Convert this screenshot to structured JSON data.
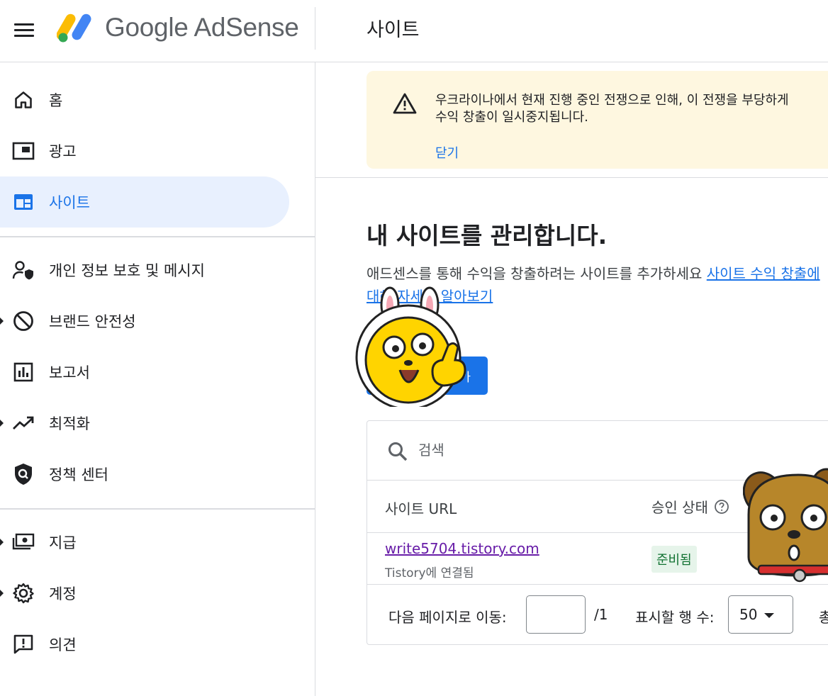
{
  "header": {
    "brand": "Google AdSense",
    "page_title": "사이트"
  },
  "sidebar": {
    "items": [
      {
        "label": "홈",
        "icon": "home-icon"
      },
      {
        "label": "광고",
        "icon": "ads-icon"
      },
      {
        "label": "사이트",
        "icon": "sites-icon",
        "active": true
      },
      {
        "label": "개인 정보 보호 및 메시지",
        "icon": "privacy-icon"
      },
      {
        "label": "브랜드 안전성",
        "icon": "block-icon",
        "expandable": true
      },
      {
        "label": "보고서",
        "icon": "report-icon"
      },
      {
        "label": "최적화",
        "icon": "trending-icon",
        "expandable": true
      },
      {
        "label": "정책 센터",
        "icon": "policy-icon"
      },
      {
        "label": "지급",
        "icon": "payments-icon",
        "expandable": true
      },
      {
        "label": "계정",
        "icon": "settings-icon",
        "expandable": true
      },
      {
        "label": "의견",
        "icon": "feedback-icon"
      }
    ]
  },
  "alert": {
    "text": "우크라이나에서 현재 진행 중인 전쟁으로 인해, 이 전쟁을 부당하게\n수익 창출이 일시중지됩니다.",
    "close_label": "닫기"
  },
  "main": {
    "heading": "내 사이트를 관리합니다.",
    "description": "애드센스를 통해 수익을 창출하려는 사이트를 추가하세요 ",
    "learn_more": "사이트 수익 창출에 대해 자세히 알아보기",
    "add_button": "추가"
  },
  "table": {
    "search_placeholder": "검색",
    "columns": [
      "사이트 URL",
      "승인 상태"
    ],
    "rows": [
      {
        "url": "write5704.tistory.com",
        "sub": "Tistory에 연결됨",
        "status": "준비됨"
      }
    ]
  },
  "pager": {
    "goto_label": "다음 페이지로 이동:",
    "page_value": "",
    "page_total": "/1",
    "rows_label": "표시할 행 수:",
    "rows_value": "50",
    "total_trunc": "총"
  },
  "colors": {
    "accent": "#1a73e8",
    "active_bg": "#e8f0fe",
    "alert_bg": "#fef7e0",
    "badge_bg": "#e6f4ea",
    "badge_text": "#137333",
    "visited_link": "#681da8"
  }
}
